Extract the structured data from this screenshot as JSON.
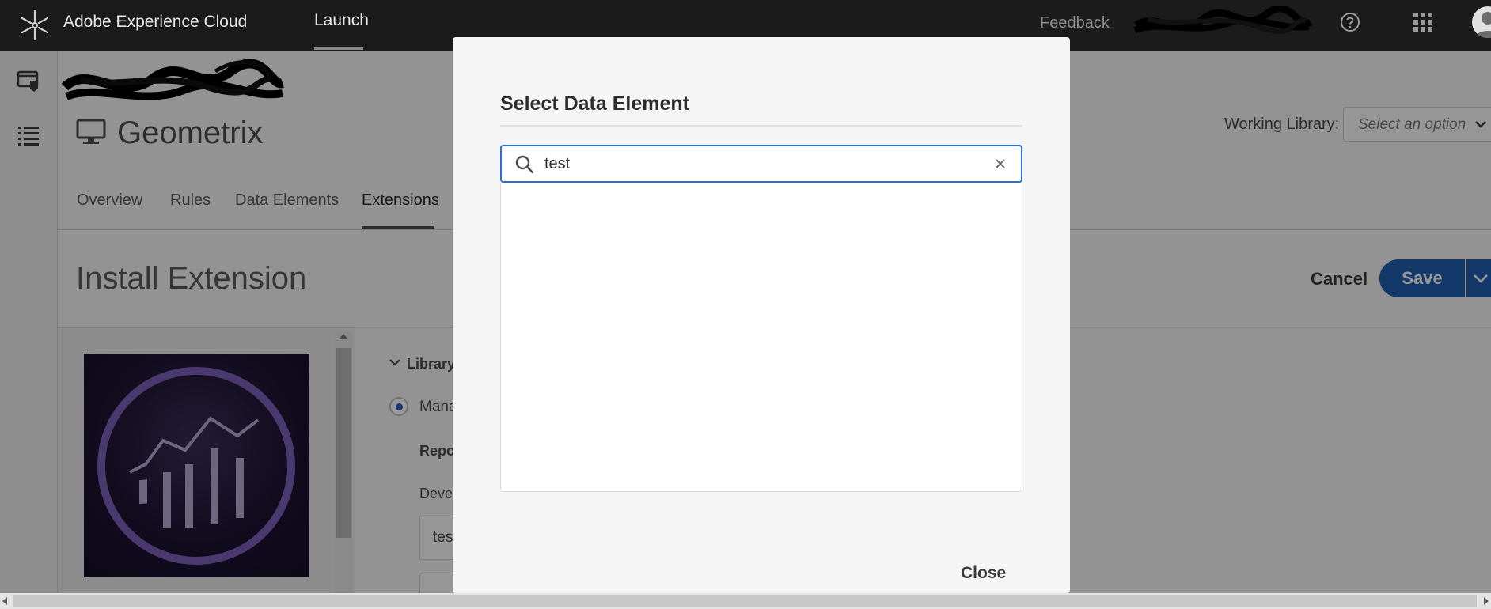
{
  "topbar": {
    "app_name": "Adobe Experience Cloud",
    "launch_tab": "Launch",
    "feedback": "Feedback",
    "icons": [
      "adobe-logo-icon",
      "help-icon",
      "apps-grid-icon",
      "user-avatar"
    ]
  },
  "rail": {
    "icons": [
      "property-icon",
      "list-icon"
    ]
  },
  "property": {
    "name": "Geometrix",
    "icon": "monitor-icon"
  },
  "working_library": {
    "label": "Working Library:",
    "placeholder": "Select an option"
  },
  "nav": {
    "tabs": [
      {
        "label": "Overview"
      },
      {
        "label": "Rules"
      },
      {
        "label": "Data Elements"
      },
      {
        "label": "Extensions",
        "active": true
      }
    ]
  },
  "page": {
    "title": "Install Extension",
    "cancel_label": "Cancel",
    "save_label": "Save"
  },
  "config": {
    "section_label": "Library",
    "radio_label": "Mana",
    "repo_label": "Repo",
    "dev_label": "Deve",
    "dev_value": "test"
  },
  "modal": {
    "title": "Select Data Element",
    "search_value": "test",
    "close_label": "Close"
  },
  "colors": {
    "accent": "#2b6fd0",
    "save_button": "#1f5fb0",
    "topbar": "#1b1b1b",
    "analytics_purple": "#7b5fb8"
  }
}
